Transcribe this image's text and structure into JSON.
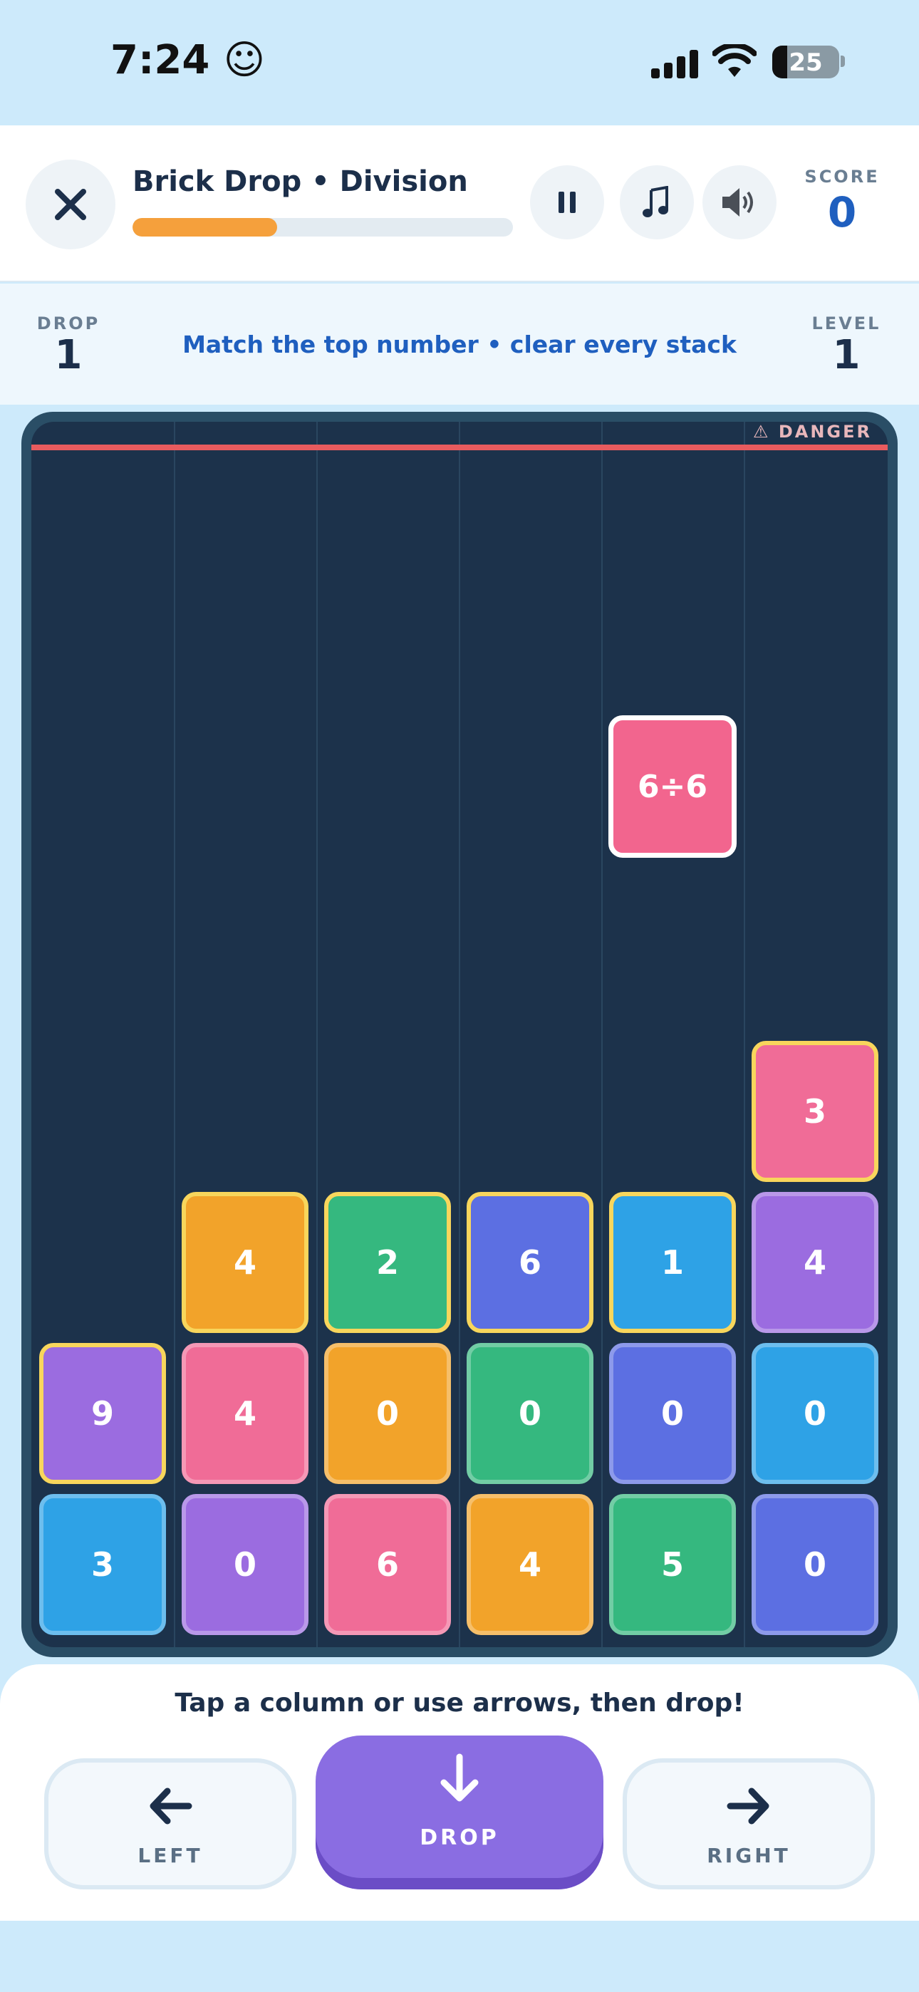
{
  "status_bar": {
    "time": "7:24 ☺",
    "battery": "25"
  },
  "header": {
    "title": "Brick Drop • Division",
    "progress": 0.38,
    "score_label": "SCORE",
    "score_value": "0",
    "icons": [
      "close-icon",
      "pause-icon",
      "music-icon",
      "speaker-icon"
    ]
  },
  "info": {
    "drop_label": "DROP",
    "drop_value": "1",
    "message": "Match the top number • clear every stack",
    "level_label": "LEVEL",
    "level_value": "1"
  },
  "board": {
    "danger_label": "⚠ DANGER",
    "falling": {
      "column": 4,
      "row_from_bottom": 6,
      "text": "6÷6",
      "color": "#f2658e"
    },
    "columns": [
      [
        {
          "v": "3",
          "color": "#2ea2e6",
          "top": false
        },
        {
          "v": "9",
          "color": "#9b6ce0",
          "top": true
        }
      ],
      [
        {
          "v": "0",
          "color": "#9b6ce0",
          "top": false
        },
        {
          "v": "4",
          "color": "#f06c97",
          "top": false
        },
        {
          "v": "4",
          "color": "#f2a32a",
          "top": true
        }
      ],
      [
        {
          "v": "6",
          "color": "#f06c97",
          "top": false
        },
        {
          "v": "0",
          "color": "#f2a32a",
          "top": false
        },
        {
          "v": "2",
          "color": "#35b87f",
          "top": true
        }
      ],
      [
        {
          "v": "4",
          "color": "#f2a32a",
          "top": false
        },
        {
          "v": "0",
          "color": "#35b87f",
          "top": false
        },
        {
          "v": "6",
          "color": "#5c6fe2",
          "top": true
        }
      ],
      [
        {
          "v": "5",
          "color": "#35b87f",
          "top": false
        },
        {
          "v": "0",
          "color": "#5c6fe2",
          "top": false
        },
        {
          "v": "1",
          "color": "#2ea2e6",
          "top": true
        }
      ],
      [
        {
          "v": "0",
          "color": "#5c6fe2",
          "top": false
        },
        {
          "v": "0",
          "color": "#2ea2e6",
          "top": false
        },
        {
          "v": "4",
          "color": "#9b6ce0",
          "top": false
        },
        {
          "v": "3",
          "color": "#f06c97",
          "top": true
        }
      ]
    ]
  },
  "controls": {
    "hint": "Tap a column or use arrows, then drop!",
    "left_label": "LEFT",
    "drop_label": "DROP",
    "right_label": "RIGHT"
  },
  "colors": {
    "accent": "#8a6de2",
    "progress": "#f5a03c",
    "highlight_border": "#f8d65c",
    "danger": "#e85b5e"
  }
}
